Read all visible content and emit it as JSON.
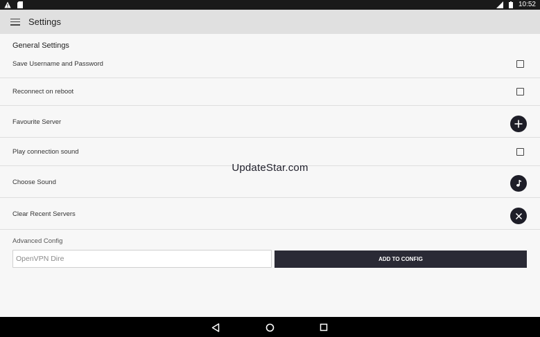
{
  "status_bar": {
    "time": "10:52",
    "left_icons": [
      "warning-icon",
      "sd-card-icon"
    ],
    "right_icons": [
      "signal-icon",
      "battery-icon"
    ]
  },
  "app_bar": {
    "title": "Settings",
    "menu_icon": "hamburger-menu-icon"
  },
  "general": {
    "title": "General Settings",
    "rows": [
      {
        "label": "Save Username and Password",
        "control": "checkbox",
        "checked": false
      },
      {
        "label": "Reconnect on reboot",
        "control": "checkbox",
        "checked": false
      },
      {
        "label": "Favourite Server",
        "control": "plus-button"
      },
      {
        "label": "Play connection sound",
        "control": "checkbox",
        "checked": false
      },
      {
        "label": "Choose Sound",
        "control": "music-note-button"
      },
      {
        "label": "Clear Recent Servers",
        "control": "close-button"
      }
    ]
  },
  "watermark": "UpdateStar.com",
  "advanced": {
    "label": "Advanced Config",
    "input_value": "",
    "input_placeholder": "OpenVPN Dire",
    "add_button_label": "ADD TO CONFIG"
  },
  "nav_bar": {
    "buttons": [
      "back-icon",
      "home-icon",
      "recents-icon"
    ]
  },
  "colors": {
    "status_bar_bg": "#1a1a1a",
    "app_bar_bg": "#e0e0e0",
    "content_bg": "#f7f7f7",
    "accent_dark": "#1e1e28",
    "nav_bar_bg": "#000000"
  }
}
